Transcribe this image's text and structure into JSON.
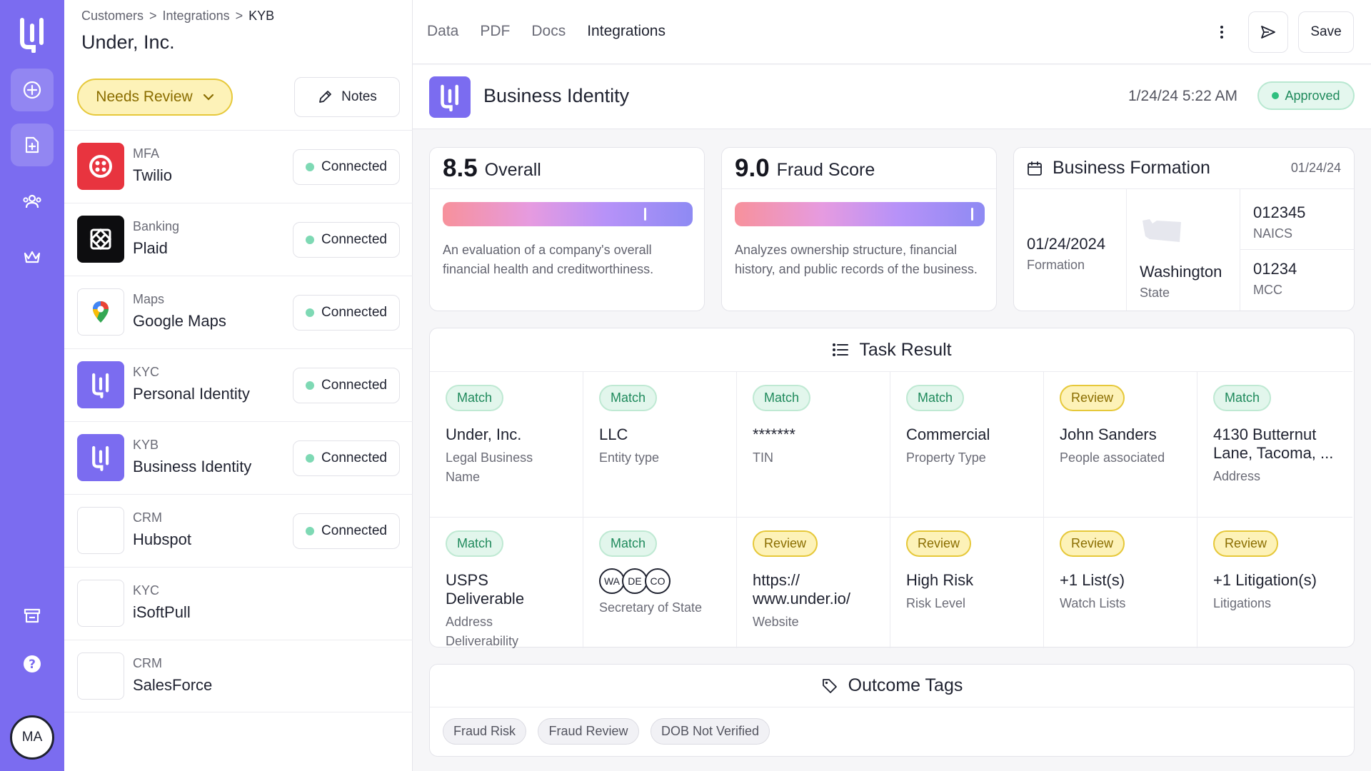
{
  "user": {
    "initials": "MA"
  },
  "breadcrumb": [
    "Customers",
    ">",
    "Integrations",
    ">",
    "KYB"
  ],
  "company_name": "Under, Inc.",
  "review_status": "Needs Review",
  "notes_label": "Notes",
  "integrations": [
    {
      "category": "MFA",
      "name": "Twilio",
      "status": "Connected",
      "logo": "twilio-logo"
    },
    {
      "category": "Banking",
      "name": "Plaid",
      "status": "Connected",
      "logo": "plaid-logo"
    },
    {
      "category": "Maps",
      "name": "Google Maps",
      "status": "Connected",
      "logo": "map-pin-icon"
    },
    {
      "category": "KYC",
      "name": "Personal Identity",
      "status": "Connected",
      "logo": "under-logo"
    },
    {
      "category": "KYB",
      "name": "Business Identity",
      "status": "Connected",
      "logo": "under-logo"
    },
    {
      "category": "CRM",
      "name": "Hubspot",
      "status": "Connected",
      "logo": "blank"
    },
    {
      "category": "KYC",
      "name": "iSoftPull",
      "status": "",
      "logo": "blank"
    },
    {
      "category": "CRM",
      "name": "SalesForce",
      "status": "",
      "logo": "blank"
    }
  ],
  "tabs": [
    {
      "label": "Data",
      "active": false
    },
    {
      "label": "PDF",
      "active": false
    },
    {
      "label": "Docs",
      "active": false
    },
    {
      "label": "Integrations",
      "active": true
    }
  ],
  "save_label": "Save",
  "page_title": "Business Identity",
  "timestamp": "1/24/24 5:22 AM",
  "approval_status": "Approved",
  "scores": {
    "overall": {
      "value": "8.5",
      "label": "Overall",
      "level": 0.81,
      "description": "An evaluation of a company's overall financial health and creditworthiness."
    },
    "fraud": {
      "value": "9.0",
      "label": "Fraud Score",
      "level": 0.95,
      "description": "Analyzes ownership structure, financial history, and public records of the business."
    }
  },
  "formation": {
    "title": "Business Formation",
    "date": "01/24/24",
    "formation_date": "01/24/2024",
    "formation_label": "Formation",
    "state": "Washington",
    "state_label": "State",
    "naics": "012345",
    "naics_label": "NAICS",
    "mcc": "01234",
    "mcc_label": "MCC"
  },
  "task_result": {
    "title": "Task Result",
    "rows": [
      [
        {
          "badge": "Match",
          "value": "Under, Inc.",
          "label": "Legal Business Name"
        },
        {
          "badge": "Match",
          "value": "LLC",
          "label": "Entity type"
        },
        {
          "badge": "Match",
          "value": "*******",
          "label": "TIN"
        },
        {
          "badge": "Match",
          "value": "Commercial",
          "label": "Property Type"
        },
        {
          "badge": "Review",
          "value": "John Sanders",
          "label": "People associated"
        },
        {
          "badge": "Match",
          "value": "4130 Butternut Lane, Tacoma, ...",
          "label": "Address"
        }
      ],
      [
        {
          "badge": "Match",
          "value": "USPS Deliverable",
          "label": "Address Deliverability"
        },
        {
          "badge": "Match",
          "value": "",
          "label": "Secretary of State",
          "states": [
            "WA",
            "DE",
            "CO"
          ]
        },
        {
          "badge": "Review",
          "value": "https:// www.under.io/",
          "label": "Website"
        },
        {
          "badge": "Review",
          "value": "High Risk",
          "label": "Risk Level"
        },
        {
          "badge": "Review",
          "value": "+1 List(s)",
          "label": "Watch Lists"
        },
        {
          "badge": "Review",
          "value": "+1 Litigation(s)",
          "label": "Litigations"
        }
      ]
    ]
  },
  "outcome_tags": {
    "title": "Outcome Tags",
    "tags": [
      "Fraud Risk",
      "Fraud Review",
      "DOB Not Verified"
    ]
  },
  "colors": {
    "brand": "#7b6cf0",
    "match": "#1f8a5c",
    "review": "#8a6d00",
    "connected_dot": "#7ed9b4"
  }
}
